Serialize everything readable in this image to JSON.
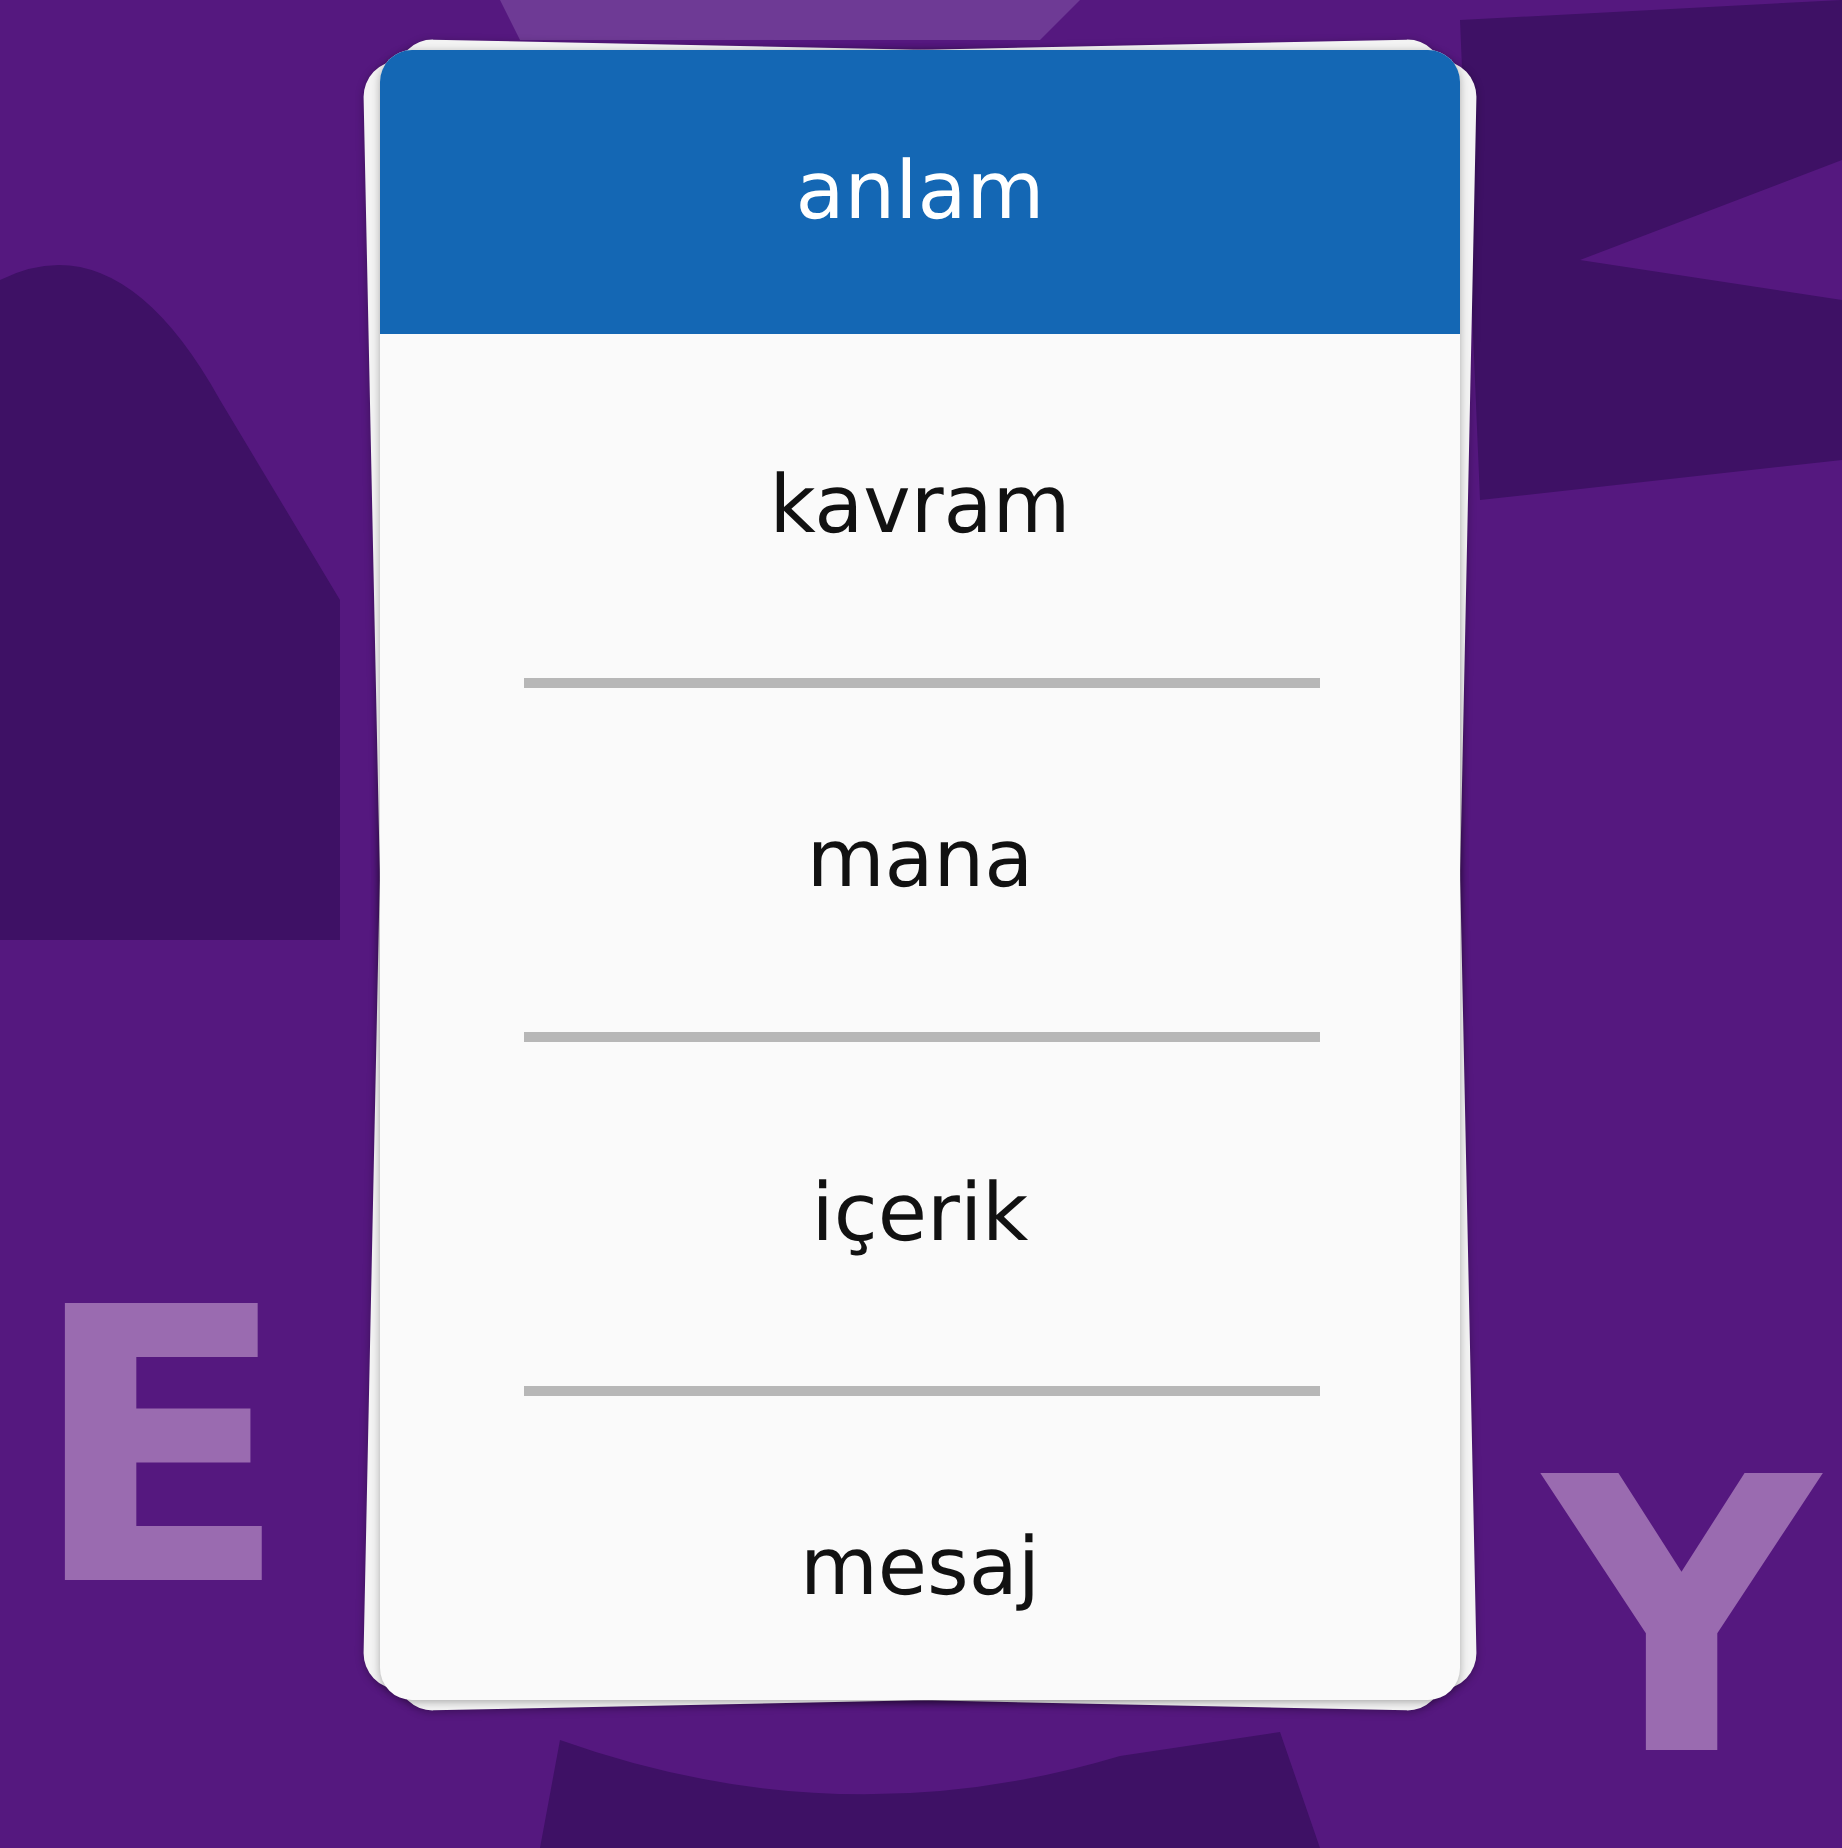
{
  "background_letters": [
    "E",
    "Y"
  ],
  "card": {
    "title": "anlam",
    "words": [
      "kavram",
      "mana",
      "içerik",
      "mesaj"
    ]
  }
}
